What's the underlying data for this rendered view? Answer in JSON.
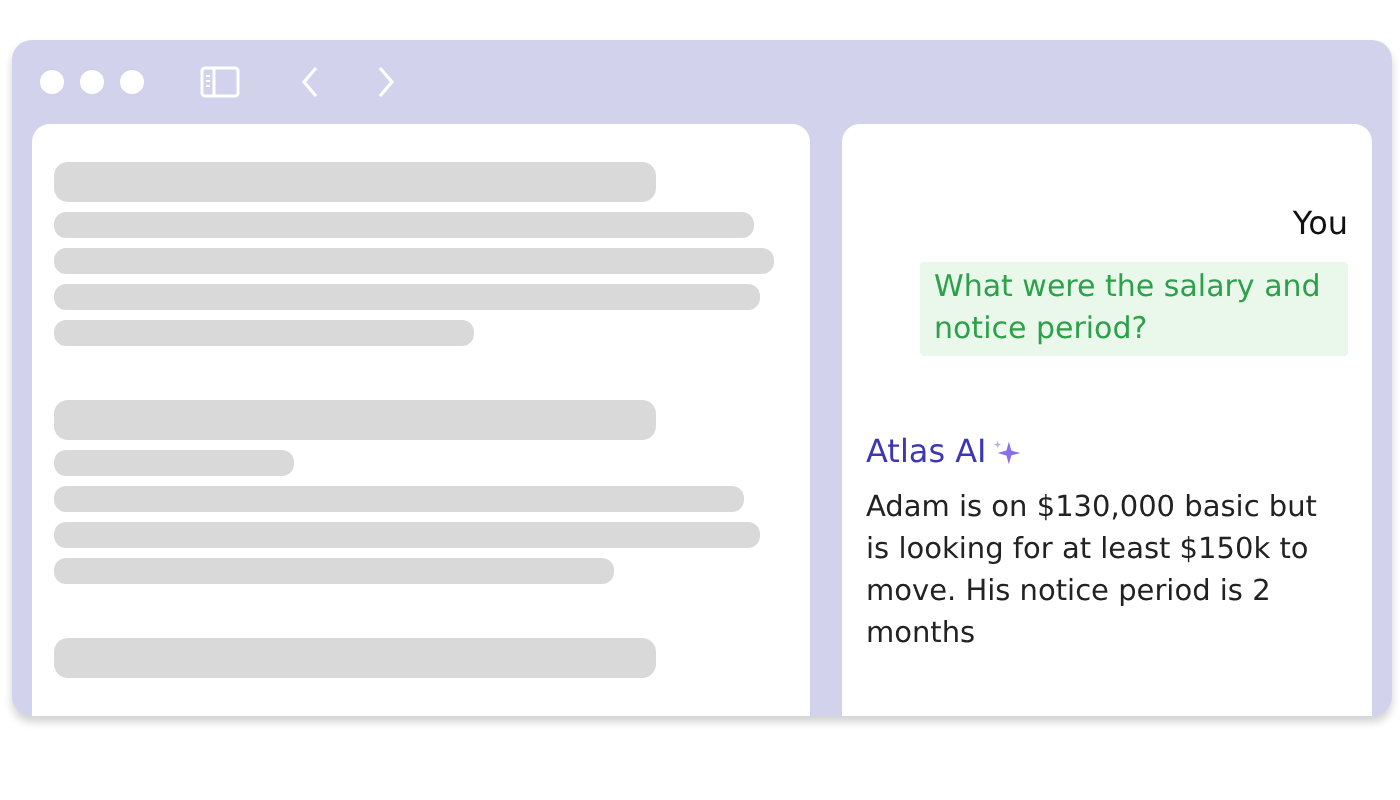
{
  "chat": [
    {
      "kind": "user",
      "author": "You",
      "text": "What were the salary and notice period?"
    },
    {
      "kind": "assistant",
      "author": "Atlas AI",
      "text": "Adam is on $130,000 basic but is looking for at least $150k to move. His notice period is 2 months"
    }
  ]
}
